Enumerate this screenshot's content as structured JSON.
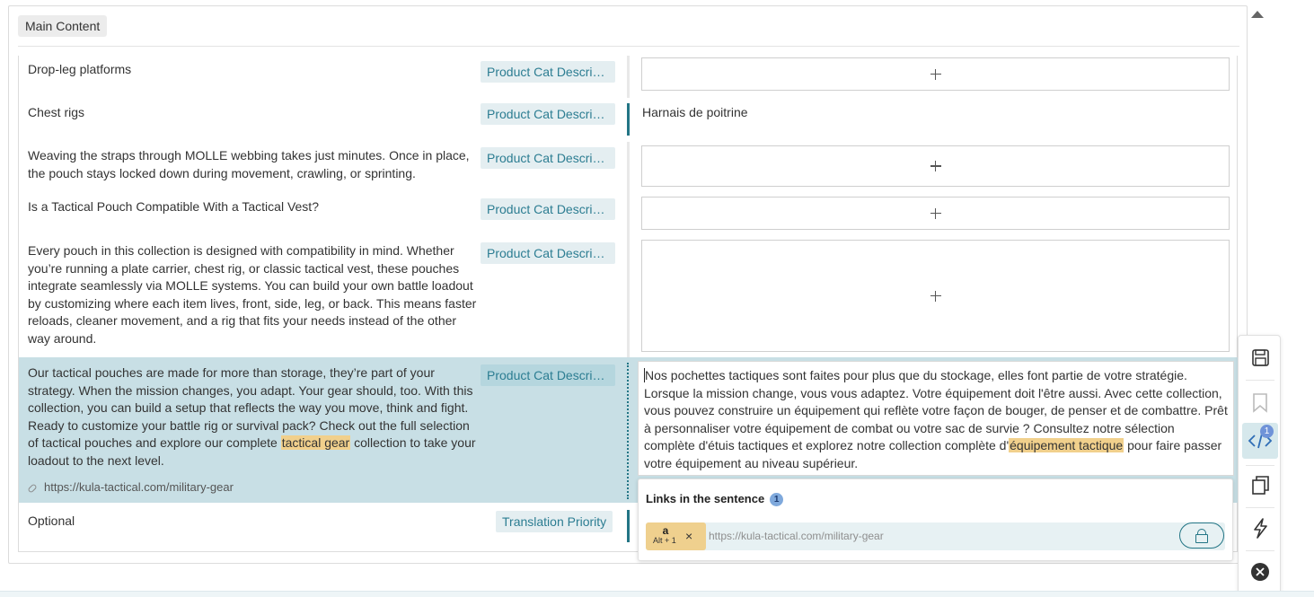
{
  "section": {
    "label": "Main Content"
  },
  "rows": [
    {
      "source": "Drop-leg platforms",
      "badge": "Product Cat Descrip..."
    },
    {
      "source": "Chest rigs",
      "badge": "Product Cat Descrip...",
      "target": "Harnais de poitrine"
    },
    {
      "source": "Weaving the straps through MOLLE webbing takes just minutes. Once in place, the pouch stays locked down during movement, crawling, or sprinting.",
      "badge": "Product Cat Descrip..."
    },
    {
      "source": "Is a Tactical Pouch Compatible With a Tactical Vest?",
      "badge": "Product Cat Descrip..."
    },
    {
      "source": "Every pouch in this collection is designed with compatibility in mind. Whether you’re running a plate carrier, chest rig, or classic tactical vest, these pouches integrate seamlessly via MOLLE systems. You can build your own battle loadout by customizing where each item lives, front, side, leg, or back. This means faster reloads, cleaner movement, and a rig that fits your needs instead of the other way around.",
      "badge": "Product Cat Descrip..."
    },
    {
      "source_before": "Our tactical pouches are made for more than storage, they’re part of your strategy. When the mission changes, you adapt. Your gear should, too. With this collection, you can build a setup that reflects the way you move, think and fight. Ready to customize your battle rig or survival pack? Check out the full selection of tactical pouches and explore our complete ",
      "source_link": "tactical gear",
      "source_after": " collection to take your loadout to the next level.",
      "url": "https://kula-tactical.com/military-gear",
      "badge": "Product Cat Descrip...",
      "target_before": "Nos pochettes tactiques sont faites pour plus que du stockage, elles font partie de votre stratégie. Lorsque la mission change, vous vous adaptez. Votre équipement doit l'être aussi. Avec cette collection, vous pouvez construire un équipement qui reflète votre façon de bouger, de penser et de combattre. Prêt à personnaliser votre équipement de combat ou votre sac de survie ? Consultez notre sélection complète d'étuis tactiques et explorez notre collection complète d'",
      "target_link": "équipement tactique",
      "target_after": " pour faire passer votre équipement au niveau supérieur."
    },
    {
      "source": "Optional",
      "badge": "Translation Priority"
    }
  ],
  "links_panel": {
    "title": "Links in the sentence",
    "count": "1",
    "chip_letter": "a",
    "chip_shortcut": "Alt + 1",
    "chip_remove": "×",
    "url": "https://kula-tactical.com/military-gear"
  },
  "toolbar": {
    "links_count": "1"
  },
  "icons": [
    "save-icon",
    "bookmark-icon",
    "code-icon",
    "copy-icon",
    "lightning-icon",
    "close-circle-icon",
    "lock-icon",
    "link-icon",
    "plus-icon"
  ]
}
